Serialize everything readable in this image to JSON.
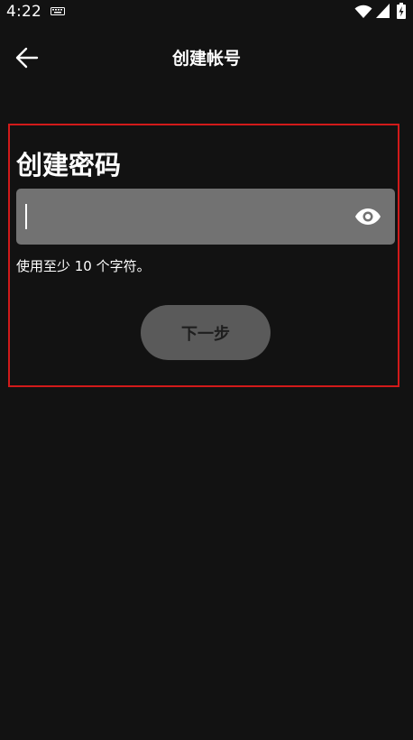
{
  "status_bar": {
    "time": "4:22",
    "icons": [
      "keyboard-icon",
      "wifi-icon",
      "signal-icon",
      "battery-icon"
    ]
  },
  "app_bar": {
    "back_icon": "arrow-left-icon",
    "title": "创建帐号"
  },
  "form": {
    "section_title": "创建密码",
    "password": {
      "value": "",
      "placeholder": "",
      "toggle_icon": "eye-icon"
    },
    "hint": "使用至少 10 个字符。",
    "next_label": "下一步"
  },
  "colors": {
    "background": "#121212",
    "field_background": "#727272",
    "button_background": "#5a5a5a",
    "button_text": "#1e1e1e",
    "highlight_border": "#d11a1a",
    "text": "#ffffff"
  }
}
